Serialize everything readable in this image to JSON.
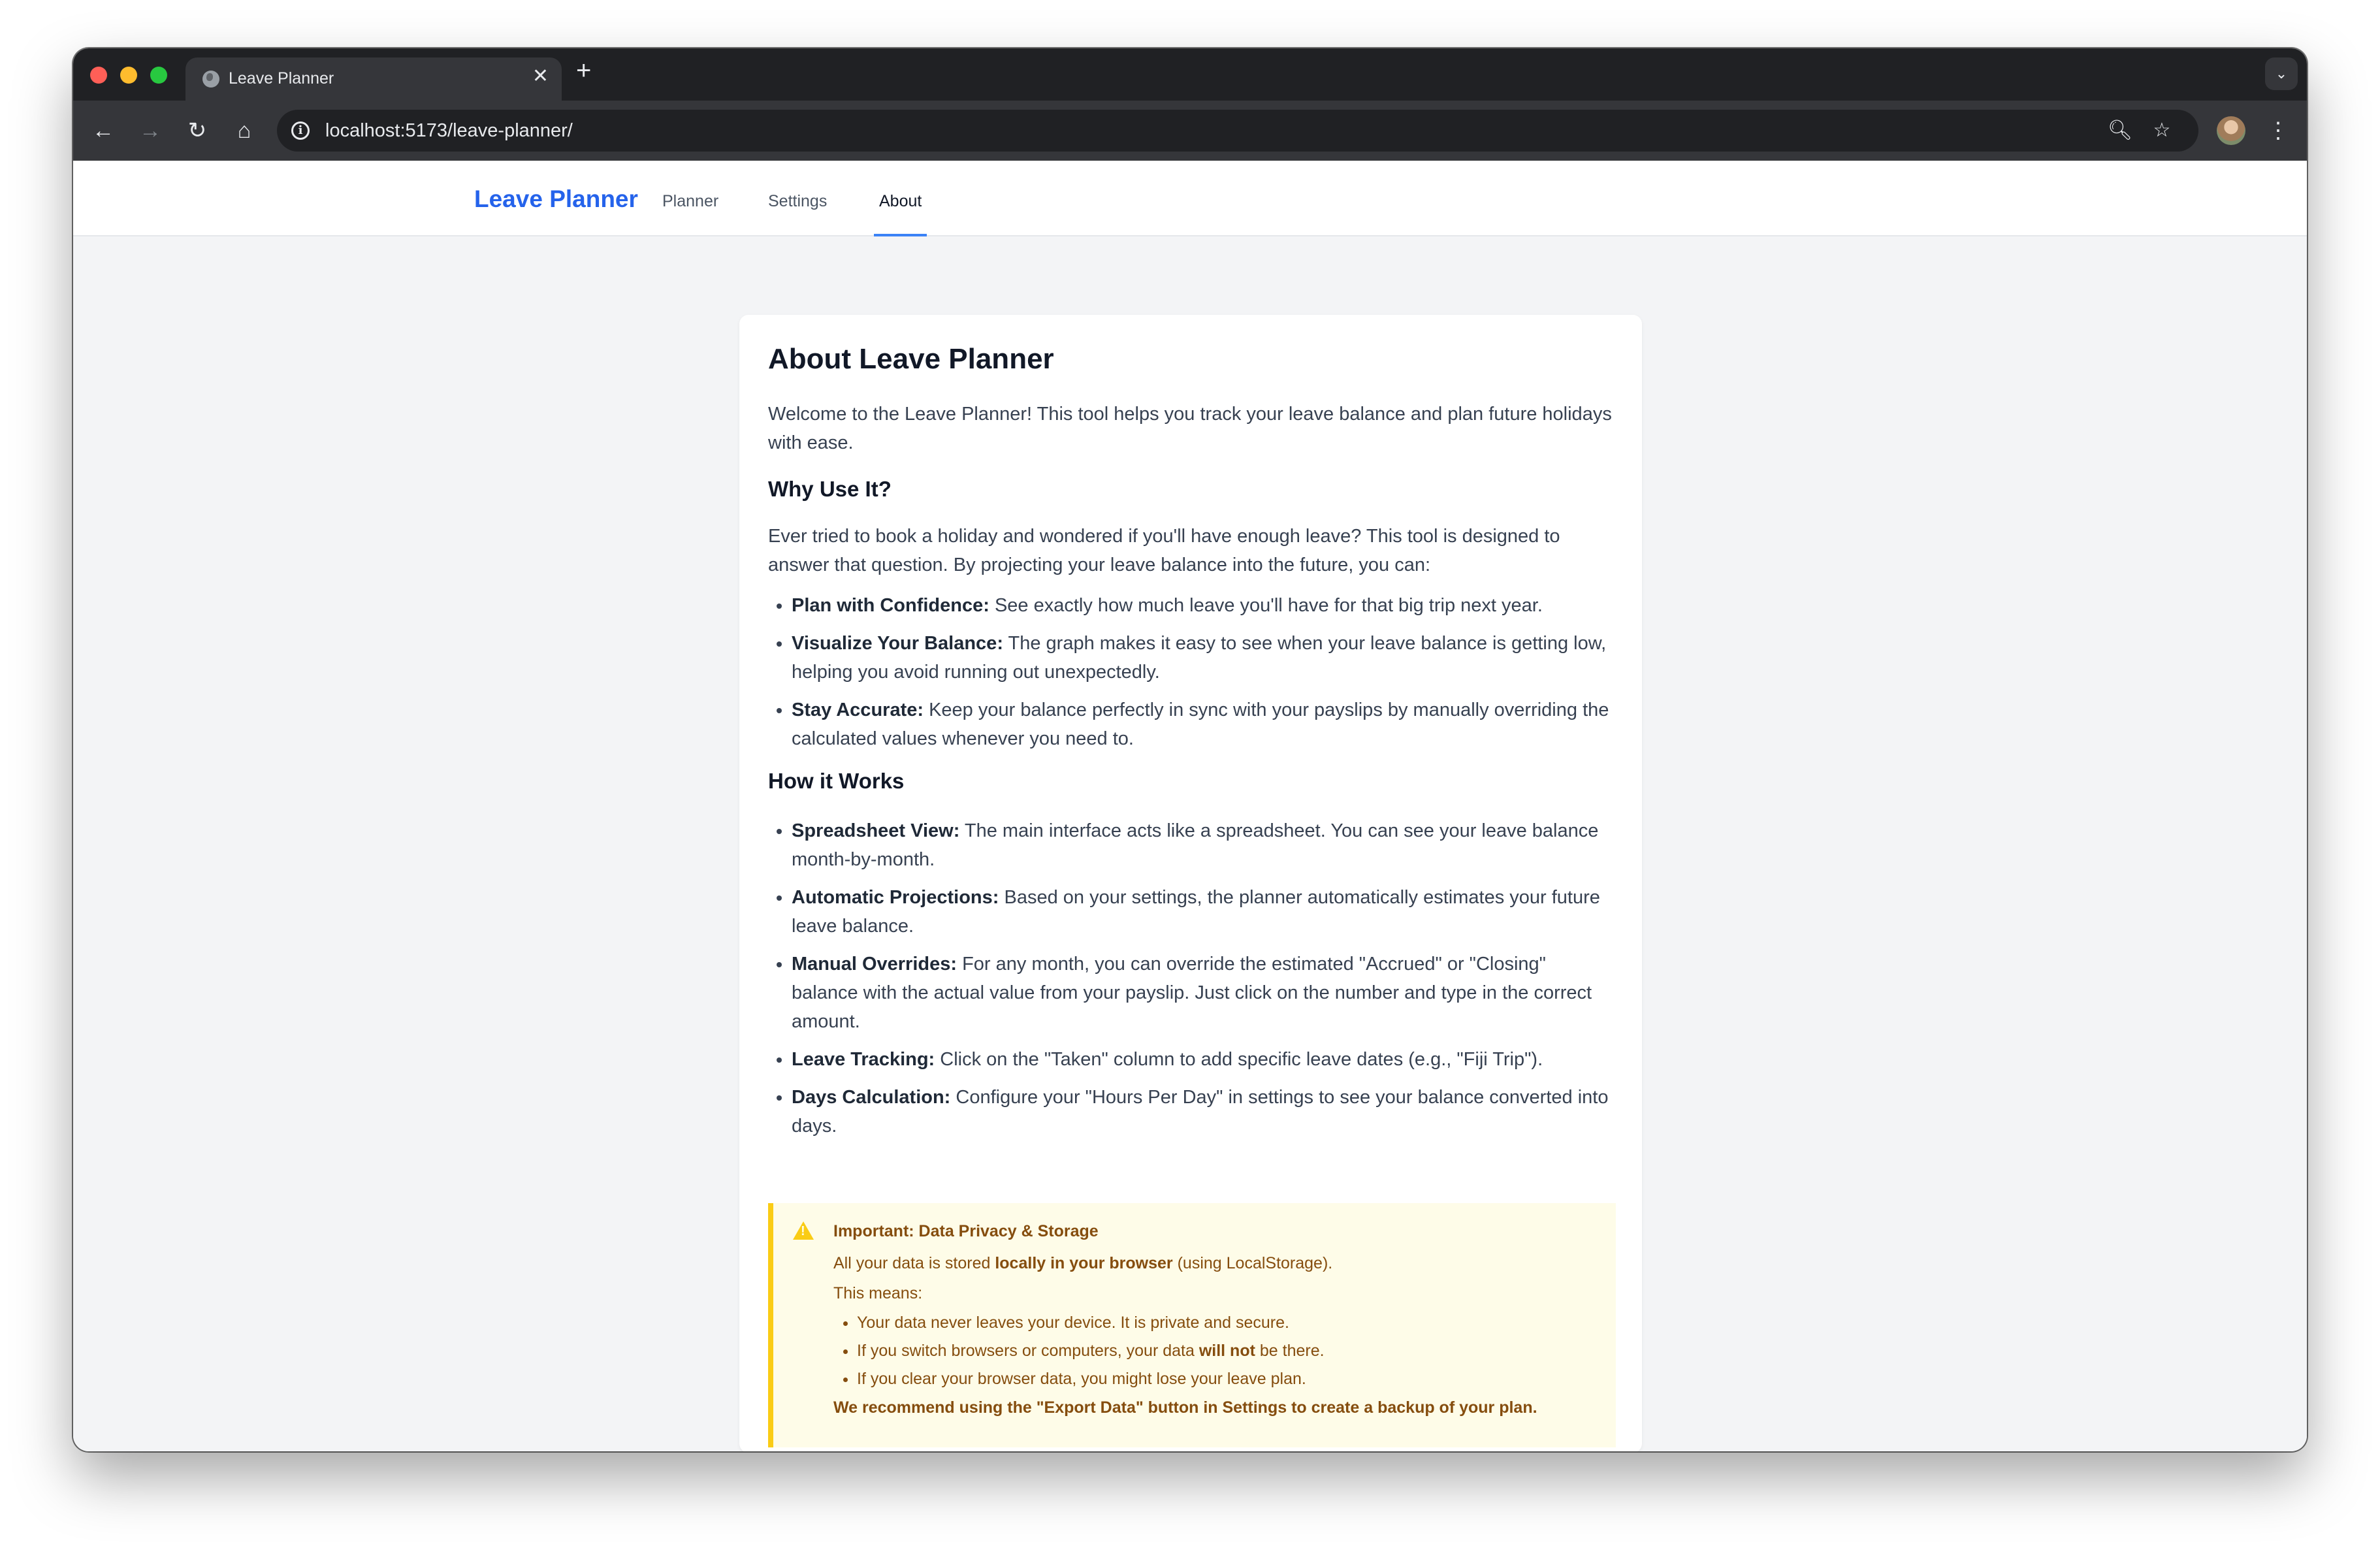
{
  "browser": {
    "tab_title": "Leave Planner",
    "tab_close": "✕",
    "new_tab": "+",
    "url": "localhost:5173/leave-planner/"
  },
  "app": {
    "brand": "Leave Planner",
    "nav": [
      {
        "label": "Planner",
        "active": false
      },
      {
        "label": "Settings",
        "active": false
      },
      {
        "label": "About",
        "active": true
      }
    ]
  },
  "about": {
    "title": "About Leave Planner",
    "intro": "Welcome to the Leave Planner! This tool helps you track your leave balance and plan future holidays with ease.",
    "why": {
      "heading": "Why Use It?",
      "text": "Ever tried to book a holiday and wondered if you'll have enough leave? This tool is designed to answer that question. By projecting your leave balance into the future, you can:",
      "items": [
        {
          "term": "Plan with Confidence:",
          "desc": " See exactly how much leave you'll have for that big trip next year."
        },
        {
          "term": "Visualize Your Balance:",
          "desc": " The graph makes it easy to see when your leave balance is getting low, helping you avoid running out unexpectedly."
        },
        {
          "term": "Stay Accurate:",
          "desc": " Keep your balance perfectly in sync with your payslips by manually overriding the calculated values whenever you need to."
        }
      ]
    },
    "how": {
      "heading": "How it Works",
      "items": [
        {
          "term": "Spreadsheet View:",
          "desc": " The main interface acts like a spreadsheet. You can see your leave balance month-by-month."
        },
        {
          "term": "Automatic Projections:",
          "desc": " Based on your settings, the planner automatically estimates your future leave balance."
        },
        {
          "term": "Manual Overrides:",
          "desc": " For any month, you can override the estimated \"Accrued\" or \"Closing\" balance with the actual value from your payslip. Just click on the number and type in the correct amount."
        },
        {
          "term": "Leave Tracking:",
          "desc": " Click on the \"Taken\" column to add specific leave dates (e.g., \"Fiji Trip\")."
        },
        {
          "term": "Days Calculation:",
          "desc": " Configure your \"Hours Per Day\" in settings to see your balance converted into days."
        }
      ]
    },
    "notice": {
      "title": "Important: Data Privacy & Storage",
      "line1_pre": "All your data is stored ",
      "line1_bold": "locally in your browser",
      "line1_post": " (using LocalStorage).",
      "means": "This means:",
      "b1": "Your data never leaves your device. It is private and secure.",
      "b2_pre": "If you switch browsers or computers, your data ",
      "b2_bold": "will not",
      "b2_post": " be there.",
      "b3": "If you clear your browser data, you might lose your leave plan.",
      "recommend": "We recommend using the \"Export Data\" button in Settings to create a backup of your plan."
    }
  }
}
